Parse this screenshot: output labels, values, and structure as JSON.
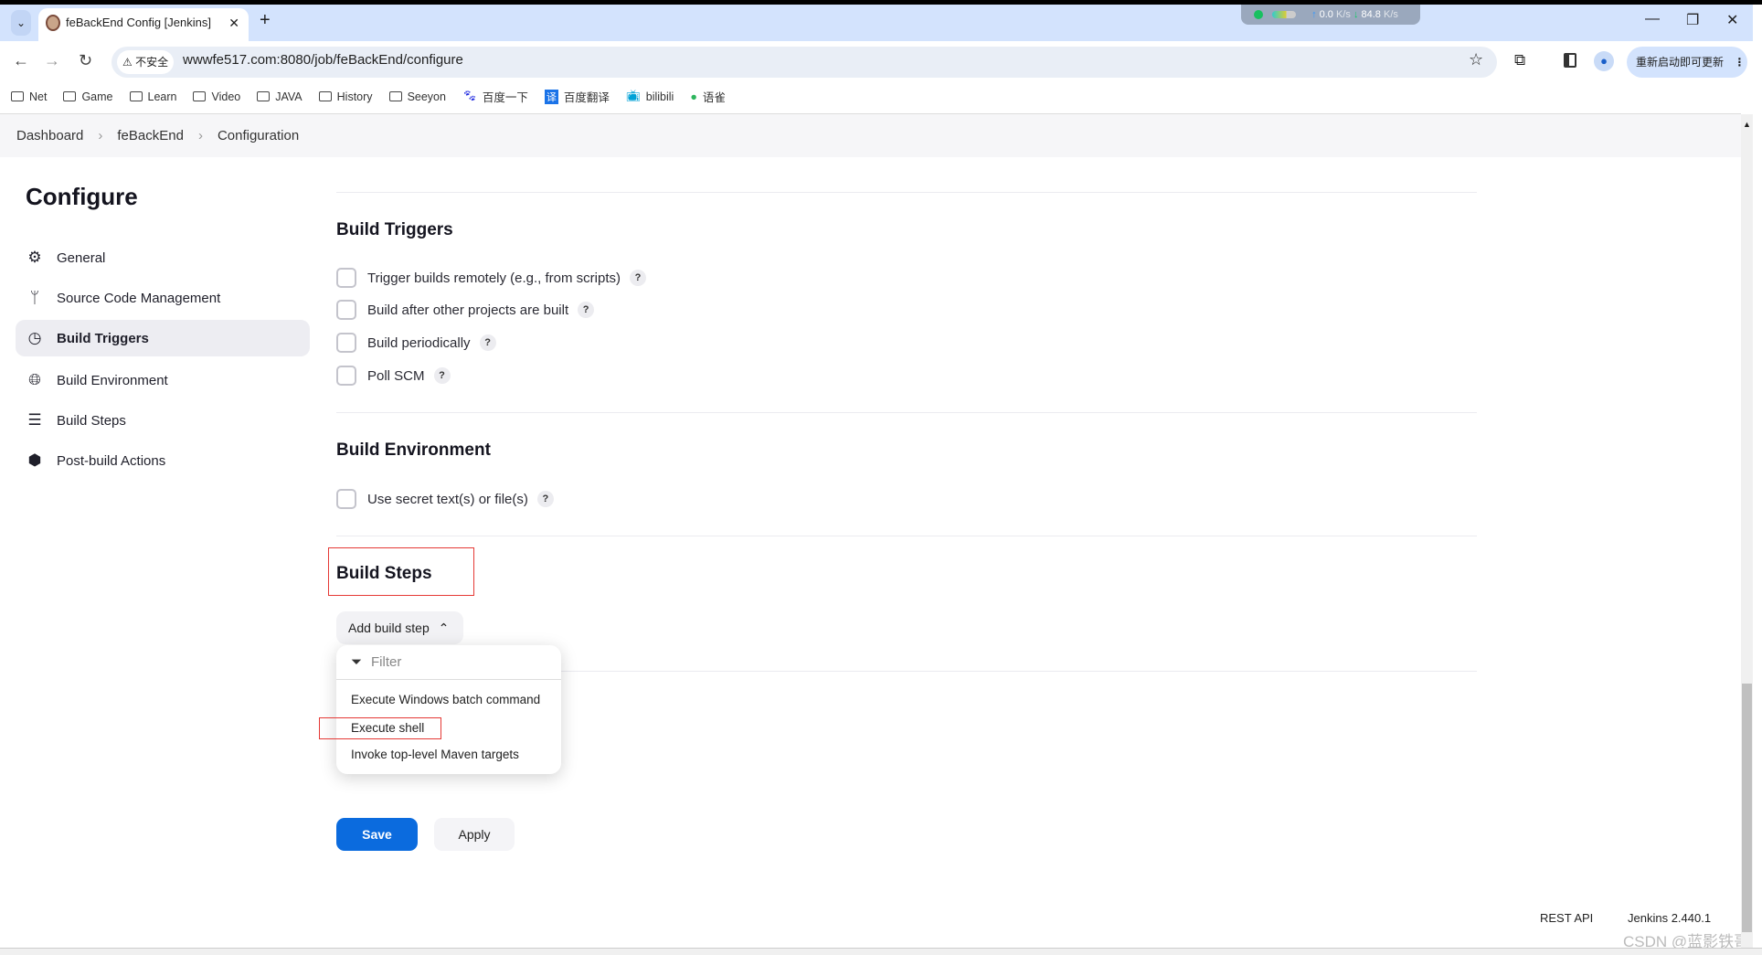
{
  "browser": {
    "tab_title": "feBackEnd Config [Jenkins]",
    "new_tab": "+",
    "tab_close": "✕",
    "netmon": {
      "up": "0.0",
      "down": "84.8",
      "unit": "K/s"
    },
    "insecure_label": "不安全",
    "url": "wwwfe517.com:8080/job/feBackEnd/configure",
    "update_label": "重新启动即可更新",
    "bookmarks": [
      {
        "label": "Net",
        "icon": "folder-icon"
      },
      {
        "label": "Game",
        "icon": "folder-icon"
      },
      {
        "label": "Learn",
        "icon": "folder-icon"
      },
      {
        "label": "Video",
        "icon": "folder-icon"
      },
      {
        "label": "JAVA",
        "icon": "folder-icon"
      },
      {
        "label": "History",
        "icon": "folder-icon"
      },
      {
        "label": "Seeyon",
        "icon": "folder-icon"
      },
      {
        "label": "百度一下",
        "icon": "baidu-icon"
      },
      {
        "label": "百度翻译",
        "icon": "translate-icon"
      },
      {
        "label": "bilibili",
        "icon": "bilibili-icon"
      },
      {
        "label": "语雀",
        "icon": "yuque-icon"
      }
    ]
  },
  "breadcrumb": [
    "Dashboard",
    "feBackEnd",
    "Configuration"
  ],
  "sidebar": {
    "title": "Configure",
    "items": [
      {
        "label": "General",
        "icon": "gear-icon"
      },
      {
        "label": "Source Code Management",
        "icon": "branch-icon"
      },
      {
        "label": "Build Triggers",
        "icon": "timer-icon",
        "selected": true
      },
      {
        "label": "Build Environment",
        "icon": "globe-icon"
      },
      {
        "label": "Build Steps",
        "icon": "list-icon"
      },
      {
        "label": "Post-build Actions",
        "icon": "package-icon"
      }
    ]
  },
  "main": {
    "build_triggers": {
      "title": "Build Triggers",
      "options": [
        {
          "label": "Trigger builds remotely (e.g., from scripts)",
          "checked": false
        },
        {
          "label": "Build after other projects are built",
          "checked": false
        },
        {
          "label": "Build periodically",
          "checked": false
        },
        {
          "label": "Poll SCM",
          "checked": false
        }
      ]
    },
    "build_environment": {
      "title": "Build Environment",
      "options": [
        {
          "label": "Use secret text(s) or file(s)",
          "checked": false
        }
      ]
    },
    "build_steps": {
      "title": "Build Steps",
      "add_button": "Add build step",
      "filter_placeholder": "Filter",
      "menu": [
        "Execute Windows batch command",
        "Execute shell",
        "Invoke top-level Maven targets"
      ]
    },
    "help": "?",
    "save": "Save",
    "apply": "Apply"
  },
  "footer": {
    "rest_api": "REST API",
    "version": "Jenkins 2.440.1"
  },
  "watermark": "CSDN @蓝影铁哥",
  "colors": {
    "accent": "#0b6bde",
    "highlight": "#e53935"
  }
}
